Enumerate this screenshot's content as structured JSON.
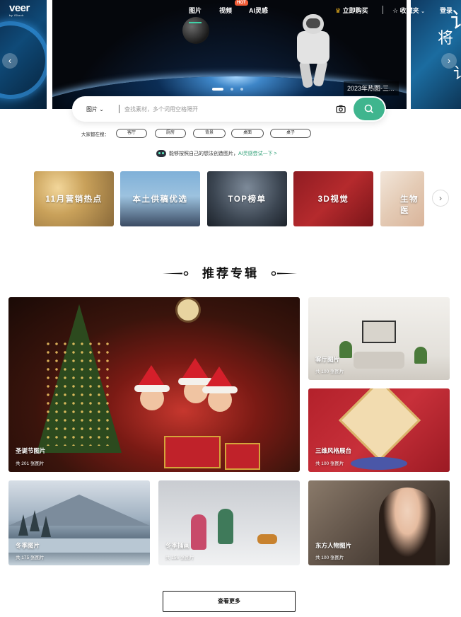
{
  "brand": {
    "logo": "veer",
    "logo_sub": "by iStock"
  },
  "nav": {
    "links": [
      {
        "label": "图片"
      },
      {
        "label": "视频"
      },
      {
        "label": "AI灵感"
      }
    ],
    "hot_badge": "HOT",
    "buy_now": "立即购买",
    "favorites": "收藏夹",
    "login": "登录"
  },
  "hero": {
    "caption": "2023年热图-三...",
    "right_chars": [
      "将",
      "讠",
      "讠"
    ],
    "active_dot": 1,
    "dot_count": 3
  },
  "search": {
    "type_selected": "图片",
    "placeholder": "查找素材，多个词用空格隔开"
  },
  "hot_searches": {
    "label": "大家都在搜：",
    "tags": [
      "客厅",
      "厨房",
      "背景",
      "桌面",
      "桌子"
    ]
  },
  "ai_promo": {
    "text": "能够按照自己的想法创造图片，",
    "link": "AI灵感尝试一下 >"
  },
  "categories": [
    {
      "label": "11月营销热点"
    },
    {
      "label": "本土供稿优选"
    },
    {
      "label": "TOP榜单"
    },
    {
      "label": "3D视觉"
    },
    {
      "label": "生物医"
    }
  ],
  "section": {
    "title": "推荐专辑"
  },
  "albums": [
    {
      "name": "圣诞节图片",
      "count": "共 201 张图片"
    },
    {
      "name": "客厅图片",
      "count": "共 100 张图片"
    },
    {
      "name": "三维风格展台",
      "count": "共 100 张图片"
    },
    {
      "name": "冬季图片",
      "count": "共 175 张图片"
    },
    {
      "name": "冬季插画",
      "count": "共 156 张图片"
    },
    {
      "name": "东方人物图片",
      "count": "共 100 张图片"
    }
  ],
  "more_button": "查看更多",
  "colors": {
    "accent": "#3fb58e",
    "hot": "#f25d37",
    "crown": "#f5b81f"
  }
}
